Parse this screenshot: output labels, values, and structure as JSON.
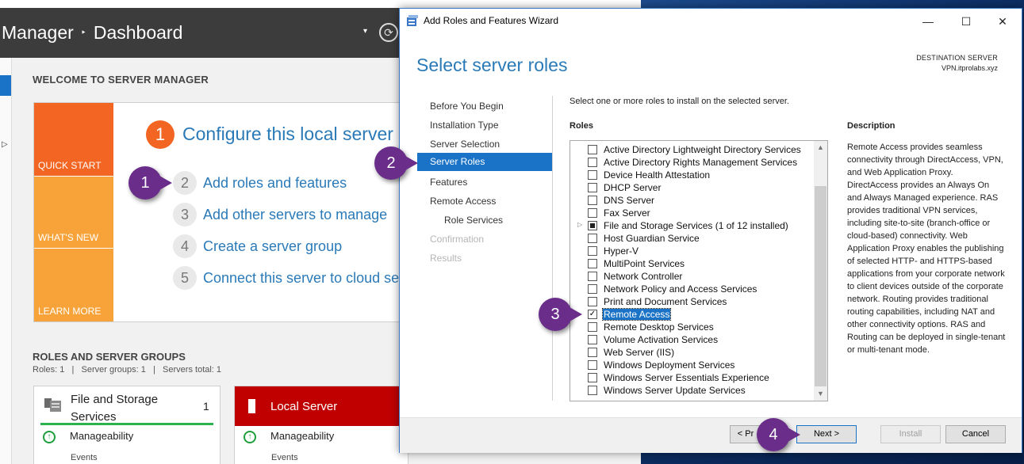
{
  "server_manager": {
    "breadcrumb_app": "Manager",
    "breadcrumb_sep": "‣",
    "breadcrumb_page": "Dashboard",
    "welcome_title": "WELCOME TO SERVER MANAGER",
    "tiles": [
      "QUICK START",
      "WHAT'S NEW",
      "LEARN MORE"
    ],
    "configure_number": "1",
    "configure_title": "Configure this local server",
    "quickstart_items": [
      {
        "num": "2",
        "text": "Add roles and features"
      },
      {
        "num": "3",
        "text": "Add other servers to manage"
      },
      {
        "num": "4",
        "text": "Create a server group"
      },
      {
        "num": "5",
        "text": "Connect this server to cloud ser"
      }
    ],
    "groups_title": "ROLES AND SERVER GROUPS",
    "groups_summary": "Roles: 1   |   Server groups: 1   |   Servers total: 1",
    "card_fs": {
      "title": "File and Storage Services",
      "count": "1",
      "manageability": "Manageability",
      "events": "Events"
    },
    "card_ls": {
      "title": "Local Server",
      "manageability": "Manageability",
      "events": "Events"
    },
    "colors": {
      "header": "#3c3c3c",
      "quick_start": "#f26522",
      "tile": "#f7a33a",
      "local_server": "#c00000",
      "link": "#2a7ab8"
    }
  },
  "wizard": {
    "title": "Add Roles and Features Wizard",
    "controls": {
      "minimize": "—",
      "maximize": "☐",
      "close": "✕"
    },
    "heading": "Select server roles",
    "destination_label": "DESTINATION SERVER",
    "destination_value": "VPN.itprolabs.xyz",
    "steps": [
      {
        "label": "Before You Begin",
        "state": "normal"
      },
      {
        "label": "Installation Type",
        "state": "normal"
      },
      {
        "label": "Server Selection",
        "state": "normal"
      },
      {
        "label": "Server Roles",
        "state": "active"
      },
      {
        "label": "Features",
        "state": "normal"
      },
      {
        "label": "Remote Access",
        "state": "normal"
      },
      {
        "label": "Role Services",
        "state": "sub"
      },
      {
        "label": "Confirmation",
        "state": "disabled"
      },
      {
        "label": "Results",
        "state": "disabled"
      }
    ],
    "intro": "Select one or more roles to install on the selected server.",
    "roles_header": "Roles",
    "description_header": "Description",
    "roles": [
      {
        "label": "Active Directory Lightweight Directory Services",
        "checked": false
      },
      {
        "label": "Active Directory Rights Management Services",
        "checked": false
      },
      {
        "label": "Device Health Attestation",
        "checked": false
      },
      {
        "label": "DHCP Server",
        "checked": false
      },
      {
        "label": "DNS Server",
        "checked": false
      },
      {
        "label": "Fax Server",
        "checked": false
      },
      {
        "label": "File and Storage Services (1 of 12 installed)",
        "checked": "partial",
        "expandable": true
      },
      {
        "label": "Host Guardian Service",
        "checked": false
      },
      {
        "label": "Hyper-V",
        "checked": false
      },
      {
        "label": "MultiPoint Services",
        "checked": false
      },
      {
        "label": "Network Controller",
        "checked": false
      },
      {
        "label": "Network Policy and Access Services",
        "checked": false
      },
      {
        "label": "Print and Document Services",
        "checked": false
      },
      {
        "label": "Remote Access",
        "checked": true,
        "selected": true
      },
      {
        "label": "Remote Desktop Services",
        "checked": false
      },
      {
        "label": "Volume Activation Services",
        "checked": false
      },
      {
        "label": "Web Server (IIS)",
        "checked": false
      },
      {
        "label": "Windows Deployment Services",
        "checked": false
      },
      {
        "label": "Windows Server Essentials Experience",
        "checked": false
      },
      {
        "label": "Windows Server Update Services",
        "checked": false
      }
    ],
    "description": "Remote Access provides seamless connectivity through DirectAccess, VPN, and Web Application Proxy. DirectAccess provides an Always On and Always Managed experience. RAS provides traditional VPN services, including site-to-site (branch-office or cloud-based) connectivity. Web Application Proxy enables the publishing of selected HTTP- and HTTPS-based applications from your corporate network to client devices outside of the corporate network. Routing provides traditional routing capabilities, including NAT and other connectivity options. RAS and Routing can be deployed in single-tenant or multi-tenant mode.",
    "buttons": {
      "previous": "< Pr",
      "next": "Next >",
      "install": "Install",
      "cancel": "Cancel"
    }
  },
  "markers": [
    "1",
    "2",
    "3",
    "4"
  ]
}
